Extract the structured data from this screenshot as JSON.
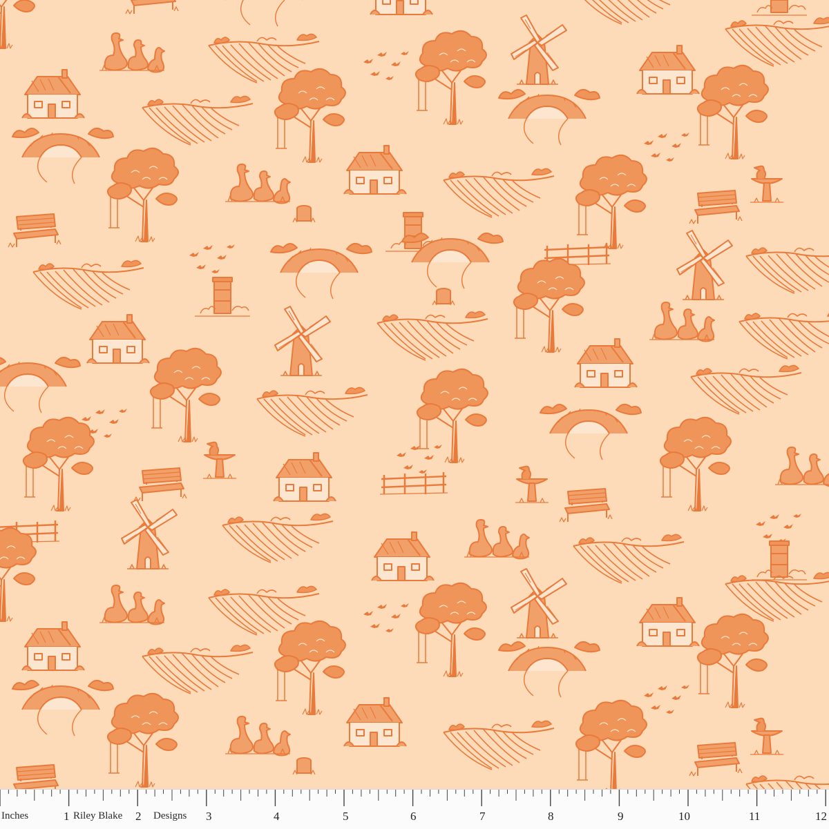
{
  "fabric": {
    "background": "#fddbb8",
    "motif_color": "#e97a3b",
    "motifs": [
      "cottage",
      "oak-tree-with-swing",
      "windmill",
      "geese",
      "farm-field",
      "stone-bridge",
      "beehive",
      "garden-bench",
      "birdbath",
      "birds-flock",
      "fence",
      "tree-stump"
    ]
  },
  "ruler": {
    "unit_label": "Inches",
    "brand_left": "Riley Blake",
    "brand_right": "Designs",
    "numbers": [
      "1",
      "2",
      "3",
      "4",
      "5",
      "6",
      "7",
      "8",
      "9",
      "10",
      "11",
      "12"
    ]
  }
}
